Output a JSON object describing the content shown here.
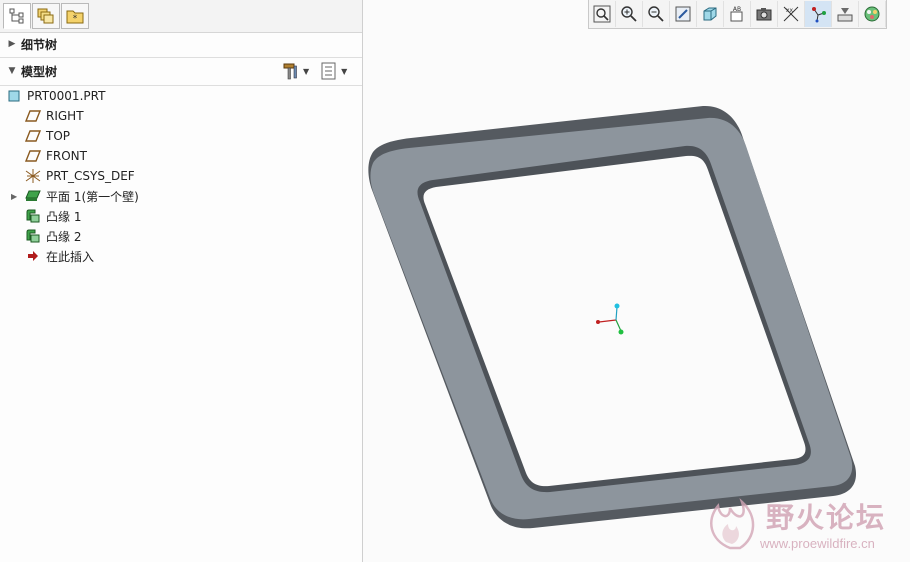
{
  "tabs": [
    {
      "icon": "structure-tree-icon"
    },
    {
      "icon": "layers-icon"
    },
    {
      "icon": "favorites-folder-icon"
    }
  ],
  "sections": {
    "detail_tree": "细节树",
    "model_tree": "模型树"
  },
  "model_tree": {
    "tools_icon": "hammer-tools-icon",
    "settings_icon": "tree-settings-icon",
    "root": "PRT0001.PRT",
    "items": [
      {
        "label": "RIGHT",
        "icon": "datum-plane-icon"
      },
      {
        "label": "TOP",
        "icon": "datum-plane-icon"
      },
      {
        "label": "FRONT",
        "icon": "datum-plane-icon"
      },
      {
        "label": "PRT_CSYS_DEF",
        "icon": "coordinate-system-icon"
      },
      {
        "label": "平面 1(第一个壁)",
        "icon": "sheetmetal-wall-icon"
      },
      {
        "label": "凸缘 1",
        "icon": "flange-icon"
      },
      {
        "label": "凸缘 2",
        "icon": "flange-icon"
      },
      {
        "label": "在此插入",
        "icon": "insert-here-arrow-icon"
      }
    ]
  },
  "toolbar": [
    {
      "name": "zoom-fit-icon"
    },
    {
      "name": "zoom-in-icon"
    },
    {
      "name": "zoom-out-icon"
    },
    {
      "name": "repaint-icon"
    },
    {
      "name": "display-style-icon"
    },
    {
      "name": "saved-views-icon"
    },
    {
      "name": "camera-icon"
    },
    {
      "name": "datum-display-icon"
    },
    {
      "name": "spin-center-icon"
    },
    {
      "name": "annotation-display-icon"
    },
    {
      "name": "appearance-gallery-icon"
    }
  ],
  "watermark": {
    "title": "野火论坛",
    "url": "www.proewildfire.cn"
  },
  "colors": {
    "model_top": "#8d959d",
    "model_side": "#555a60",
    "accent": "#d4e4f4",
    "watermark": "#d3a6b6"
  }
}
